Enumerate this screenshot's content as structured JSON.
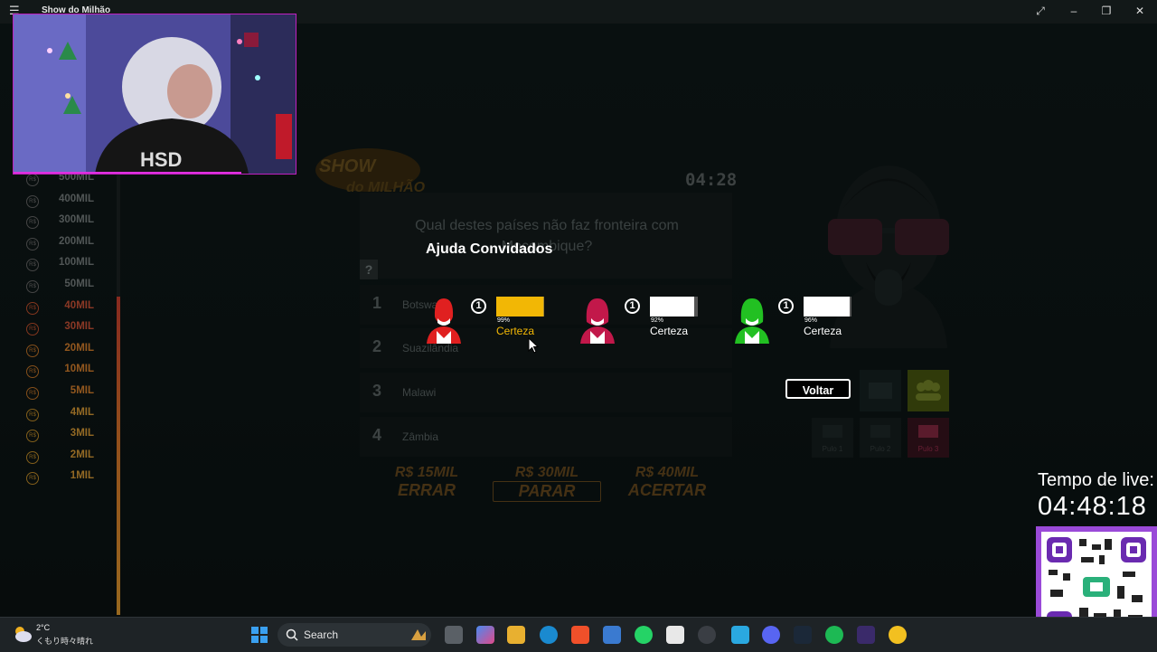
{
  "window": {
    "title": "Show do Milhão"
  },
  "ladder": [
    {
      "label": "500MIL",
      "tier": "grey"
    },
    {
      "label": "400MIL",
      "tier": "grey"
    },
    {
      "label": "300MIL",
      "tier": "grey"
    },
    {
      "label": "200MIL",
      "tier": "grey"
    },
    {
      "label": "100MIL",
      "tier": "grey"
    },
    {
      "label": "50MIL",
      "tier": "grey"
    },
    {
      "label": "40MIL",
      "tier": "hot"
    },
    {
      "label": "30MIL",
      "tier": "hot"
    },
    {
      "label": "20MIL",
      "tier": "warm"
    },
    {
      "label": "10MIL",
      "tier": "warm"
    },
    {
      "label": "5MIL",
      "tier": "warm"
    },
    {
      "label": "4MIL",
      "tier": "gold"
    },
    {
      "label": "3MIL",
      "tier": "gold"
    },
    {
      "label": "2MIL",
      "tier": "gold"
    },
    {
      "label": "1MIL",
      "tier": "gold"
    }
  ],
  "coin_symbol": "R$",
  "timer": "04:28",
  "question": {
    "text": "Qual destes países não faz fronteira com Moçambique?",
    "help_icon": "?",
    "answers": [
      {
        "num": "1",
        "text": "Botswana"
      },
      {
        "num": "2",
        "text": "Suazilândia"
      },
      {
        "num": "3",
        "text": "Malawi"
      },
      {
        "num": "4",
        "text": "Zâmbia"
      }
    ]
  },
  "stakes": {
    "errar": {
      "value": "R$ 15MIL",
      "label": "ERRAR"
    },
    "parar": {
      "value": "R$ 30MIL",
      "label": "PARAR"
    },
    "acertar": {
      "value": "R$ 40MIL",
      "label": "ACERTAR"
    }
  },
  "pulo_labels": [
    "Pulo 1",
    "Pulo 2",
    "Pulo 3"
  ],
  "help_overlay": {
    "title": "Ajuda Convidados",
    "guests": [
      {
        "answer": "1",
        "percent": "99%",
        "certainty": 0.99,
        "label": "Certeza",
        "color": "#f2b705",
        "avatar_color": "#e02020"
      },
      {
        "answer": "1",
        "percent": "92%",
        "certainty": 0.92,
        "label": "Certeza",
        "color": "#ffffff",
        "avatar_color": "#c2184a"
      },
      {
        "answer": "1",
        "percent": "96%",
        "certainty": 0.96,
        "label": "Certeza",
        "color": "#ffffff",
        "avatar_color": "#22c022"
      }
    ],
    "back_button": "Voltar"
  },
  "stream": {
    "live_label": "Tempo de live:",
    "live_time": "04:48:18"
  },
  "taskbar": {
    "weather_temp": "2°C",
    "weather_desc": "くもり時々晴れ",
    "search_label": "Search"
  },
  "colors": {
    "accent": "#e8a030",
    "hot": "#d5573a",
    "gold": "#f2b705"
  }
}
